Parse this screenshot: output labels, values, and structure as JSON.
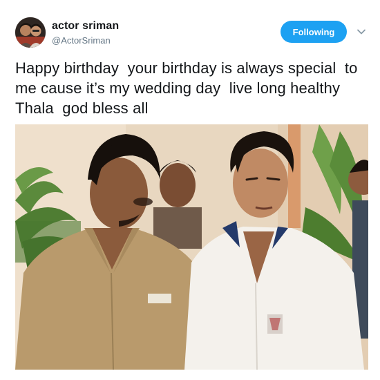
{
  "account": {
    "display_name": "actor sriman",
    "handle": "@ActorSriman",
    "avatar_icon": "profile-photo"
  },
  "follow_button": {
    "label": "Following",
    "color": "#1da1f2"
  },
  "menu_icon": "chevron-down-icon",
  "tweet": {
    "text": "Happy birthday  your birthday is always special  to me cause it’s my wedding day  live long healthy  Thala  god bless all"
  },
  "media": {
    "kind": "film-still-photo"
  },
  "colors": {
    "text_primary": "#14171a",
    "text_secondary": "#657786",
    "accent": "#1da1f2"
  }
}
